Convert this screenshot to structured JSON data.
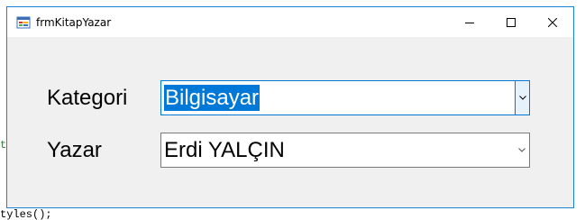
{
  "window": {
    "title": "frmKitapYazar"
  },
  "background": {
    "code_fragment_left": "t",
    "code_fragment_bottom": "tyles();"
  },
  "form": {
    "kategori_label": "Kategori",
    "kategori_value": "Bilgisayar",
    "yazar_label": "Yazar",
    "yazar_value": "Erdi YALÇIN"
  },
  "icons": {
    "app": "form-app-icon",
    "minimize": "minimize-icon",
    "maximize": "maximize-icon",
    "close": "close-icon",
    "dropdown": "chevron-down-icon"
  },
  "colors": {
    "accent": "#0078d7",
    "window_border": "#1883d7",
    "form_background": "#f0f0f0"
  }
}
